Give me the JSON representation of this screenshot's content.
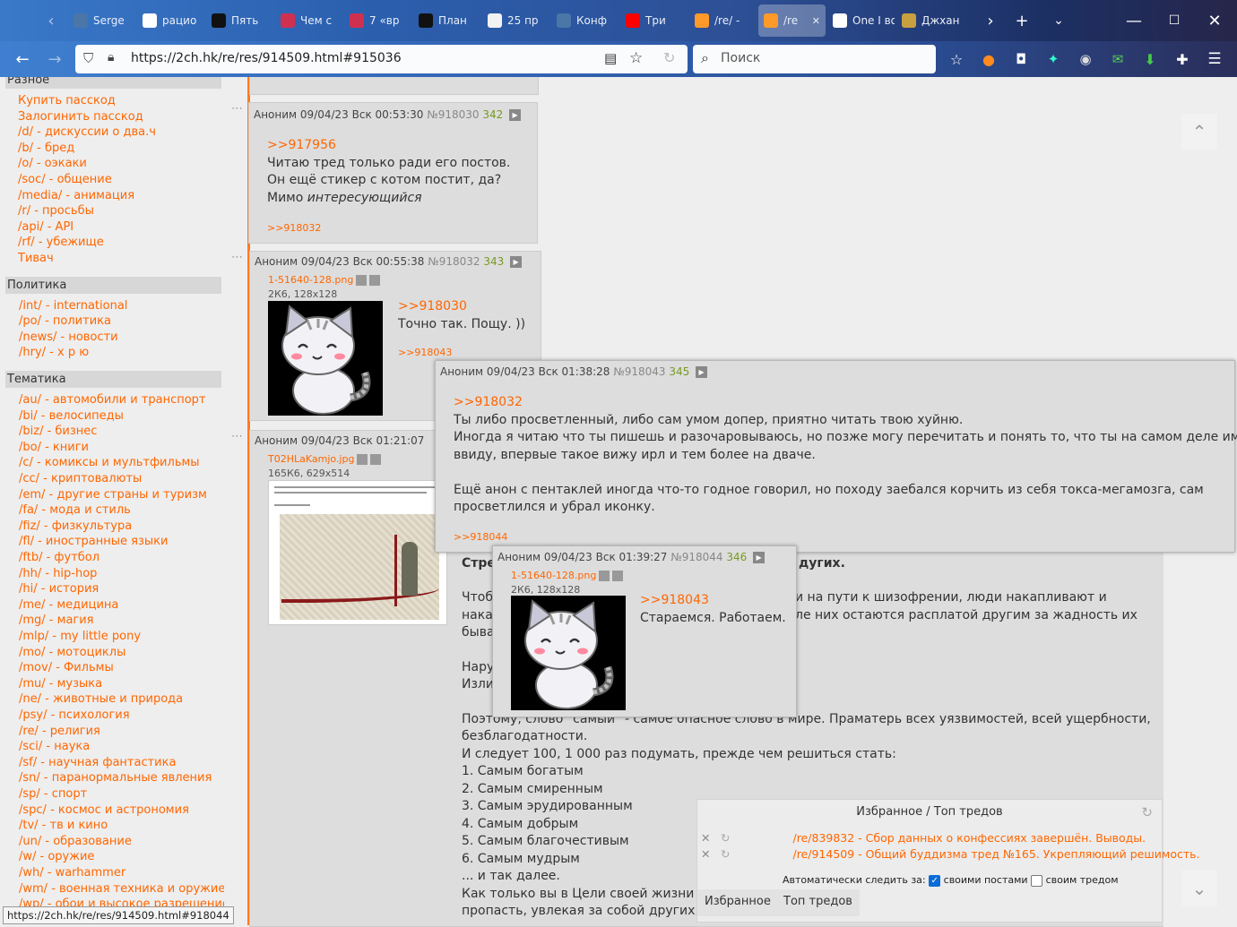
{
  "tabs": [
    {
      "label": "Serge",
      "fav": "vk-icon",
      "color": "#4a76a8"
    },
    {
      "label": "рацио",
      "fav": "google-icon",
      "color": "#ffffff"
    },
    {
      "label": "Пять",
      "fav": "cat-icon",
      "color": "#111111"
    },
    {
      "label": "Чем с",
      "fav": "heart-icon",
      "color": "#d03050"
    },
    {
      "label": "7 «вр",
      "fav": "heart-icon",
      "color": "#d03050"
    },
    {
      "label": "План",
      "fav": "star-icon",
      "color": "#111111"
    },
    {
      "label": "25 пр",
      "fav": "compass-icon",
      "color": "#f2f2f2"
    },
    {
      "label": "Конф",
      "fav": "vk-icon",
      "color": "#4a76a8"
    },
    {
      "label": "Три",
      "fav": "youtube-icon",
      "color": "#ff0000"
    },
    {
      "label": "/re/ -",
      "fav": "bolt-icon",
      "color": "#ff9a2a"
    },
    {
      "label": "/re",
      "fav": "bolt-icon",
      "color": "#ff9a2a",
      "active": true
    },
    {
      "label": "One I восп",
      "fav": "play-icon",
      "color": "#ffffff"
    },
    {
      "label": "Джхан",
      "fav": "wheel-icon",
      "color": "#c8a040"
    }
  ],
  "url": "https://2ch.hk/re/res/914509.html#915036",
  "search_placeholder": "Поиск",
  "sidebar": {
    "sections": [
      {
        "title": "Разное",
        "links": [
          "Купить пасскод",
          "Залогинить пасскод",
          "/d/ - дискуссии о два.ч",
          "/b/ - бред",
          "/o/ - оэкаки",
          "/soc/ - общение",
          "/media/ - анимация",
          "/r/ - просьбы",
          "/api/ - API",
          "/rf/ - убежище",
          "Тивач"
        ]
      },
      {
        "title": "Политика",
        "links": [
          "/int/ - international",
          "/po/ - политика",
          "/news/ - новости",
          "/hry/ - х р ю"
        ]
      },
      {
        "title": "Тематика",
        "links": [
          "/au/ - автомобили и транспорт",
          "/bi/ - велосипеды",
          "/biz/ - бизнес",
          "/bo/ - книги",
          "/c/ - комиксы и мультфильмы",
          "/cc/ - криптовалюты",
          "/em/ - другие страны и туризм",
          "/fa/ - мода и стиль",
          "/fiz/ - физкультура",
          "/fl/ - иностранные языки",
          "/ftb/ - футбол",
          "/hh/ - hip-hop",
          "/hi/ - история",
          "/me/ - медицина",
          "/mg/ - магия",
          "/mlp/ - my little pony",
          "/mo/ - мотоциклы",
          "/mov/ - Фильмы",
          "/mu/ - музыка",
          "/ne/ - животные и природа",
          "/psy/ - психология",
          "/re/ - религия",
          "/sci/ - наука",
          "/sf/ - научная фантастика",
          "/sn/ - паранормальные явления",
          "/sp/ - спорт",
          "/spc/ - космос и астрономия",
          "/tv/ - тв и кино",
          "/un/ - образование",
          "/w/ - оружие",
          "/wh/ - warhammer",
          "/wm/ - военная техника и оружие",
          "/wp/ - обои и высокое разрешение"
        ]
      }
    ]
  },
  "posts": {
    "p918030": {
      "author": "Аноним",
      "date": "09/04/23 Вск 00:53:30",
      "num": "№918030",
      "count": "342",
      "reply": ">>917956",
      "lines": [
        "Читаю тред только ради его постов.",
        "Он ещё стикер с котом постит, да?"
      ],
      "italic_prefix": "Мимо ",
      "italic": "интересующийся",
      "backlink": ">>918032"
    },
    "p918032": {
      "author": "Аноним",
      "date": "09/04/23 Вск 00:55:38",
      "num": "№918032",
      "count": "343",
      "file": "1-51640-128.png",
      "info": "2К6, 128x128",
      "reply": ">>918030",
      "text": "Точно так. Пощу. ))",
      "backlink": ">>918043"
    },
    "p_long": {
      "author": "Аноним",
      "date": "09/04/23 Вск 01:21:07",
      "file": "T02HLaKamjo.jpg",
      "info": "165К6, 629x514",
      "visible": [
        {
          "t": "Стре",
          "b": true
        },
        {
          "t": "дугих.",
          "b": true
        },
        {
          "t": "Чтоб"
        },
        {
          "t": "и на пути к шизофрении, люди накапливают и"
        },
        {
          "t": "накап"
        },
        {
          "t": "ле них остаются расплатой другим за жадность их"
        },
        {
          "t": "быва"
        },
        {
          "t": "Нару"
        },
        {
          "t": "Изли"
        },
        {
          "t": "Поэтому, слово \"самый\" - самое опасное слово в мире. Праматерь всех уязвимостей, всей ущербности,"
        },
        {
          "t": "безблагодатности."
        },
        {
          "t": "И следует 100, 1 000 раз подумать, прежде чем решиться стать:"
        },
        {
          "t": "1. Самым богатым"
        },
        {
          "t": "2. Самым смиренным"
        },
        {
          "t": "3. Самым эрудированным"
        },
        {
          "t": "4. Самым добрым"
        },
        {
          "t": "5. Самым благочестивым"
        },
        {
          "t": "6. Самым мудрым"
        },
        {
          "t": "... и так далее."
        },
        {
          "t": "Как только вы в Цели своей жизни уг"
        },
        {
          "t": "пропасть, увлекая за собой других."
        }
      ]
    },
    "p918043": {
      "author": "Аноним",
      "date": "09/04/23 Вск 01:38:28",
      "num": "№918043",
      "count": "345",
      "reply": ">>918032",
      "lines": [
        "Ты либо просветленный, либо сам умом допер, приятно читать твою хуйню.",
        "Иногда я читаю что ты пишешь и разочаровываюсь, но позже могу перечитать и понять то, что ты на самом деле имел",
        "ввиду, впервые такое вижу ирл и тем более на дваче.",
        "",
        "Ещё анон с пентаклей иногда что-то годное говорил, но походу заебался корчить из себя токса-мегамозга, сам",
        "просветлился и убрал иконку."
      ],
      "backlink": ">>918044"
    },
    "p918044": {
      "author": "Аноним",
      "date": "09/04/23 Вск 01:39:27",
      "num": "№918044",
      "count": "346",
      "file": "1-51640-128.png",
      "info": "2К6, 128x128",
      "reply": ">>918043",
      "text": "Стараемся. Работаем."
    }
  },
  "favorites": {
    "title": "Избранное / Топ тредов",
    "items": [
      "/re/839832 - Сбор данных о конфессиях завершён. Выводы.",
      "/re/914509 - Общий буддизма тред №165. Укрепляющий решимость."
    ],
    "auto_label": "Автоматически следить за:",
    "opt1": "своими постами",
    "opt2": "своим тредом",
    "tab1": "Избранное",
    "tab2": "Топ тредов"
  },
  "status_url": "https://2ch.hk/re/res/914509.html#918044",
  "colors": {
    "accent": "#ff6600",
    "greentext": "#789922",
    "post_bg": "#dddddd"
  }
}
